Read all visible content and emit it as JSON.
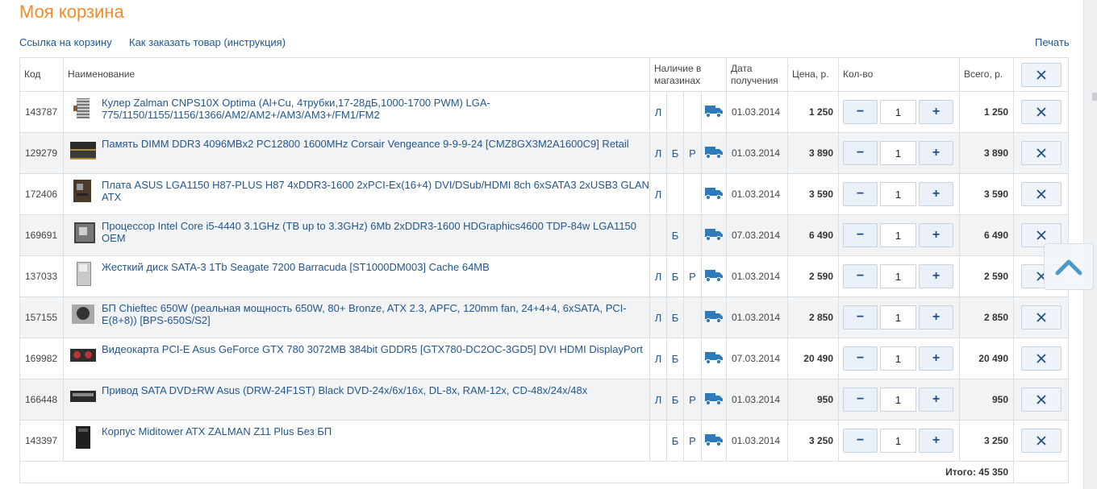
{
  "page": {
    "title": "Моя корзина",
    "links": {
      "cart_link": "Ссылка на корзину",
      "how_to_order": "Как заказать товар (инструкция)",
      "print": "Печать"
    }
  },
  "table": {
    "headers": {
      "code": "Код",
      "name": "Наименование",
      "stock": "Наличие в магазинах",
      "date": "Дата получения",
      "price": "Цена, р.",
      "qty": "Кол-во",
      "total": "Всего, р."
    },
    "rows": [
      {
        "code": "143787",
        "name": "Кулер Zalman CNPS10X Optima (Al+Cu, 4трубки,17-28дБ,1000-1700 PWM) LGA-775/1150/1155/1156/1366/AM2/AM2+/AM3/AM3+/FM1/FM2",
        "thumb": "cooler-icon",
        "stock": [
          "Л",
          "",
          ""
        ],
        "date": "01.03.2014",
        "price": "1 250",
        "qty": "1",
        "total": "1 250"
      },
      {
        "code": "129279",
        "name": "Память DIMM DDR3 4096MBx2 PC12800 1600MHz Corsair Vengeance 9-9-9-24 [CMZ8GX3M2A1600C9] Retail",
        "thumb": "ram-icon",
        "stock": [
          "Л",
          "Б",
          "Р"
        ],
        "date": "01.03.2014",
        "price": "3 890",
        "qty": "1",
        "total": "3 890"
      },
      {
        "code": "172406",
        "name": "Плата ASUS LGA1150 H87-PLUS H87 4xDDR3-1600 2xPCI-Ex(16+4) DVI/DSub/HDMI 8ch 6xSATA3 2xUSB3 GLAN ATX",
        "thumb": "motherboard-icon",
        "stock": [
          "Л",
          "",
          ""
        ],
        "date": "01.03.2014",
        "price": "3 590",
        "qty": "1",
        "total": "3 590"
      },
      {
        "code": "169691",
        "name": "Процессор Intel Core i5-4440 3.1GHz (TB up to 3.3GHz) 6Mb 2xDDR3-1600 HDGraphics4600 TDP-84w LGA1150 OEM",
        "thumb": "cpu-icon",
        "stock": [
          "",
          "Б",
          ""
        ],
        "date": "07.03.2014",
        "price": "6 490",
        "qty": "1",
        "total": "6 490"
      },
      {
        "code": "137033",
        "name": "Жесткий диск SATA-3 1Tb Seagate 7200 Barracuda [ST1000DM003] Cache 64MB",
        "thumb": "hdd-icon",
        "stock": [
          "Л",
          "Б",
          "Р"
        ],
        "date": "01.03.2014",
        "price": "2 590",
        "qty": "1",
        "total": "2 590"
      },
      {
        "code": "157155",
        "name": "БП Chieftec 650W (реальная мощность 650W, 80+ Bronze, ATX 2.3, APFC, 120mm fan, 24+4+4, 6xSATA, PCI-E(8+8)) [BPS-650S/S2]",
        "thumb": "psu-icon",
        "stock": [
          "Л",
          "Б",
          ""
        ],
        "date": "01.03.2014",
        "price": "2 850",
        "qty": "1",
        "total": "2 850"
      },
      {
        "code": "169982",
        "name": "Видеокарта PCI-E Asus GeForce GTX 780 3072MB 384bit GDDR5 [GTX780-DC2OC-3GD5] DVI HDMI DisplayPort",
        "thumb": "gpu-icon",
        "stock": [
          "Л",
          "Б",
          ""
        ],
        "date": "07.03.2014",
        "price": "20 490",
        "qty": "1",
        "total": "20 490"
      },
      {
        "code": "166448",
        "name": "Привод SATA DVD±RW Asus (DRW-24F1ST) Black DVD-24x/6x/16x, DL-8x, RAM-12x, CD-48x/24x/48x",
        "thumb": "dvd-drive-icon",
        "stock": [
          "Л",
          "Б",
          "Р"
        ],
        "date": "01.03.2014",
        "price": "950",
        "qty": "1",
        "total": "950"
      },
      {
        "code": "143397",
        "name": "Корпус Miditower ATX ZALMAN Z11 Plus Без БП",
        "thumb": "pc-case-icon",
        "stock": [
          "",
          "Б",
          "Р"
        ],
        "date": "01.03.2014",
        "price": "3 250",
        "qty": "1",
        "total": "3 250"
      }
    ],
    "qty_minus": "−",
    "qty_plus": "+",
    "footer_total": "Итого: 45 350"
  },
  "icons": {
    "delivery": "truck-icon",
    "delete": "close-icon",
    "scroll_top": "chevron-up-icon"
  },
  "colors": {
    "title": "#f08c2b",
    "link": "#23568e",
    "truck": "#2f7ab8",
    "border": "#dadfe3"
  }
}
